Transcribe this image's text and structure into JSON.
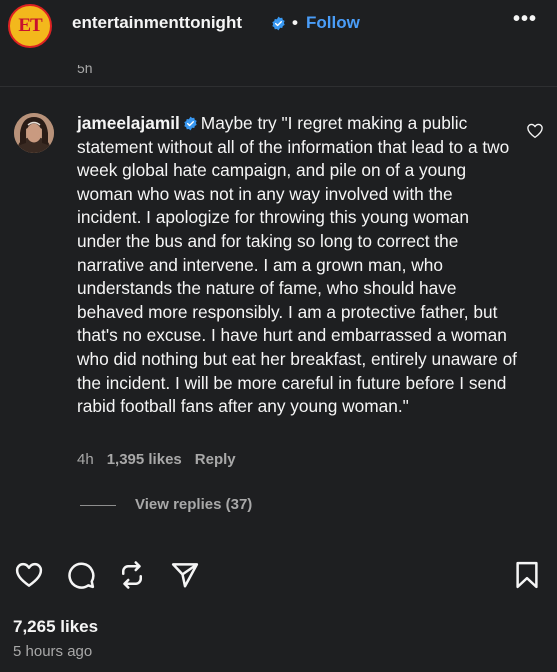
{
  "header": {
    "logo_text": "ET",
    "account_name": "entertainmenttonight",
    "separator": "•",
    "follow_label": "Follow",
    "more_label": "•••"
  },
  "previous_timestamp": "5h",
  "comment": {
    "username": "jameelajamil",
    "text": "Maybe try \"I regret making a public statement without all of the information that lead to a two week global hate campaign, and pile on of a young woman who was not in any way involved with the incident. I apologize for throwing this young woman under the bus and for taking so long to correct the narrative and intervene. I am a grown man, who understands the nature of fame, who should have behaved more responsibly. I am a protective father, but that's no excuse. I have hurt and embarrassed a woman who did nothing but eat her breakfast, entirely unaware of the incident. I will be more careful in future before I send rabid football fans after any young woman.\"",
    "timestamp": "4h",
    "likes": "1,395 likes",
    "reply_label": "Reply",
    "view_replies_label": "View replies (37)"
  },
  "post": {
    "likes": "7,265 likes",
    "posted_time": "5 hours ago"
  },
  "icons": {
    "like": "heart-icon",
    "comment": "comment-bubble-icon",
    "repost": "repost-icon",
    "share": "send-icon",
    "save": "bookmark-icon",
    "verified": "verified-badge-icon"
  },
  "colors": {
    "background": "#1e1f21",
    "link": "#4a9df8",
    "verified": "#3897f0",
    "muted": "#a8a8a8"
  }
}
